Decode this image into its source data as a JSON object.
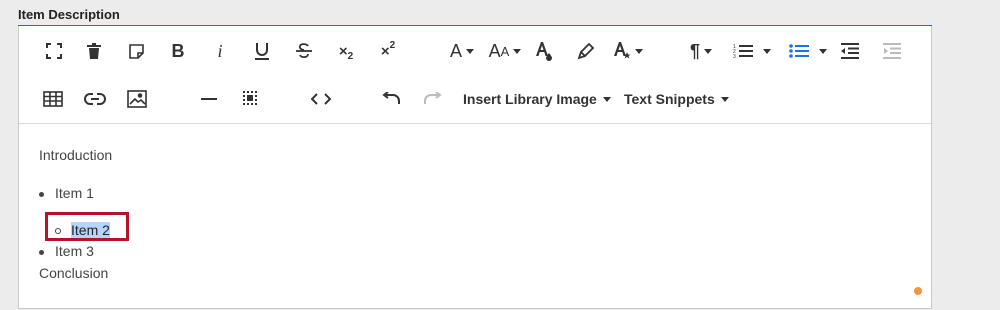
{
  "field": {
    "label": "Item Description"
  },
  "toolbar": {
    "row1": [
      "fullscreen-icon",
      "trash-icon",
      "clear-formatting-icon",
      "bold-icon",
      "italic-icon",
      "underline-icon",
      "strikethrough-icon",
      "subscript-icon",
      "superscript-icon",
      "font-family-icon",
      "font-size-icon",
      "text-color-icon",
      "highlight-icon",
      "inline-style-icon",
      "paragraph-format-icon",
      "ordered-list-icon",
      "unordered-list-icon",
      "outdent-icon",
      "indent-icon"
    ],
    "row2": [
      "table-icon",
      "link-icon",
      "image-icon",
      "horizontal-line-icon",
      "select-all-icon",
      "code-view-icon",
      "undo-icon",
      "redo-icon"
    ],
    "insert_library_image": "Insert Library Image",
    "text_snippets": "Text Snippets"
  },
  "content": {
    "intro": "Introduction",
    "items": [
      "Item 1",
      "Item 2",
      "Item 3"
    ],
    "conclusion": "Conclusion"
  },
  "colors": {
    "accent_blue": "#1a73e8",
    "highlight_red": "#b5122e",
    "selection": "#b4d5fe",
    "indicator": "#f29441"
  }
}
